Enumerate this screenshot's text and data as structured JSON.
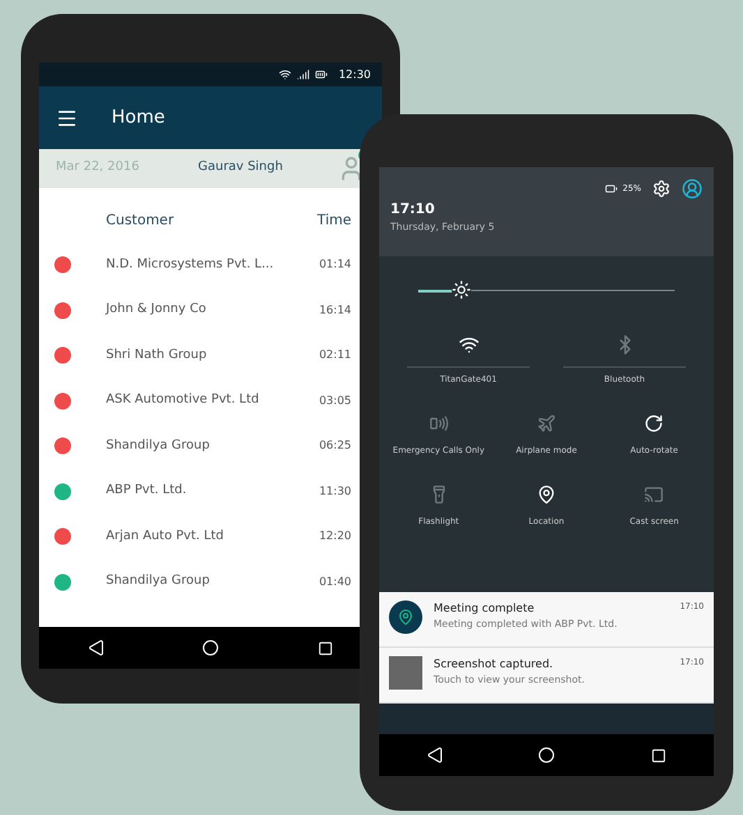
{
  "phone_left": {
    "status_bar": {
      "time": "12:30"
    },
    "app_bar": {
      "title": "Home"
    },
    "info_row": {
      "date": "Mar 22, 2016",
      "user": "Gaurav Singh",
      "online": true
    },
    "table": {
      "columns": [
        "Customer",
        "Time"
      ],
      "rows": [
        {
          "customer": "N.D. Microsystems Pvt. L...",
          "time": "01:14",
          "color": "#ef4b4b"
        },
        {
          "customer": "John & Jonny Co",
          "time": "16:14",
          "color": "#ef4b4b"
        },
        {
          "customer": "Shri Nath Group",
          "time": "02:11",
          "color": "#ef4b4b"
        },
        {
          "customer": "ASK Automotive Pvt. Ltd",
          "time": "03:05",
          "color": "#ef4b4b"
        },
        {
          "customer": "Shandilya Group",
          "time": "06:25",
          "color": "#ef4b4b"
        },
        {
          "customer": "ABP Pvt. Ltd.",
          "time": "11:30",
          "color": "#1fb584"
        },
        {
          "customer": "Arjan Auto Pvt. Ltd",
          "time": "12:20",
          "color": "#ef4b4b"
        },
        {
          "customer": "Shandilya Group",
          "time": "01:40",
          "color": "#1fb584"
        }
      ]
    }
  },
  "phone_right": {
    "header": {
      "battery": "25%",
      "time": "17:10",
      "date": "Thursday, February 5"
    },
    "brightness": {
      "level": 0.17
    },
    "tiles": [
      {
        "label": "TitanGate401",
        "on": true
      },
      {
        "label": "Bluetooth",
        "on": false
      },
      {
        "label": "Emergency Calls Only",
        "on": false
      },
      {
        "label": "Airplane mode",
        "on": false
      },
      {
        "label": "Auto-rotate",
        "on": true
      },
      {
        "label": "Flashlight",
        "on": false
      },
      {
        "label": "Location",
        "on": true
      },
      {
        "label": "Cast screen",
        "on": false
      }
    ],
    "notifications": [
      {
        "kind": "app",
        "title": "Meeting complete",
        "body": "Meeting completed with ABP Pvt. Ltd.",
        "time": "17:10"
      },
      {
        "kind": "screenshot",
        "title": "Screenshot captured.",
        "body": "Touch to view your screenshot.",
        "time": "17:10"
      }
    ]
  }
}
